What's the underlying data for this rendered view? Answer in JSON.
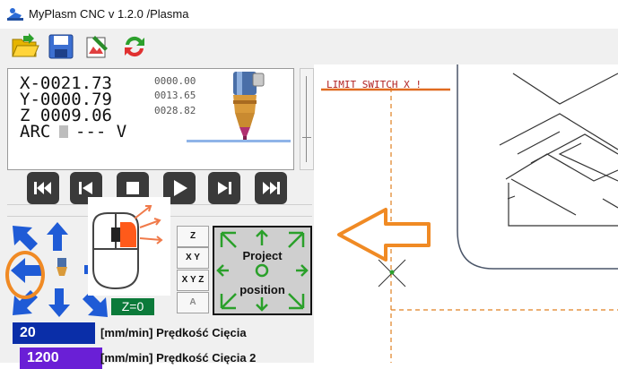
{
  "window": {
    "title": "MyPlasm CNC v 1.2.0  /Plasma"
  },
  "toolbar": {
    "icons": [
      "open-folder-icon",
      "save-icon",
      "edit-image-icon",
      "refresh-icon"
    ]
  },
  "coordinates": {
    "x": "X-0021.73",
    "y": "Y-0000.79",
    "z": "Z 0009.06",
    "arc": "ARC",
    "arc_value": "---  V",
    "small_x": "0000.00",
    "small_y": "0013.65",
    "small_z": "0028.82"
  },
  "playback": {
    "icons": [
      "skip-start-icon",
      "step-back-icon",
      "stop-icon",
      "play-icon",
      "step-forward-icon",
      "skip-end-icon"
    ]
  },
  "axis_buttons": {
    "z": "Z",
    "xy": "X Y",
    "xyz": "X Y Z",
    "a": "A"
  },
  "project_button": {
    "line1": "Project",
    "line2": "position"
  },
  "z_zero": "Z=0",
  "speeds": [
    {
      "value": "20",
      "label": "[mm/min] Prędkość Cięcia",
      "color": "#0a2ea8"
    },
    {
      "value": "1200",
      "label": "[mm/min] Prędkość Cięcia 2",
      "color": "#6a1fd6"
    }
  ],
  "canvas": {
    "status_message": "LIMIT SWITCH X !"
  },
  "colors": {
    "accent_orange": "#f08a24",
    "status_red": "#b22222",
    "toolbar_bg": "#f0f0f0"
  }
}
